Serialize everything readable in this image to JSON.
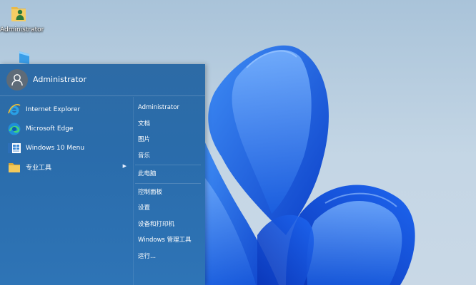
{
  "desktop": {
    "icons": [
      {
        "label": "Administrator",
        "icon": "user-folder-icon"
      },
      {
        "label": "",
        "icon": "this-pc-icon"
      }
    ]
  },
  "start_menu": {
    "user": {
      "name": "Administrator",
      "icon": "user-avatar-icon"
    },
    "programs": [
      {
        "label": "Internet Explorer",
        "icon": "internet-explorer-icon"
      },
      {
        "label": "Microsoft Edge",
        "icon": "microsoft-edge-icon"
      },
      {
        "label": "Windows 10 Menu",
        "icon": "windows-10-menu-icon"
      },
      {
        "label": "专业工具",
        "icon": "folder-icon",
        "has_submenu": true
      }
    ],
    "places": {
      "group1": [
        "Administrator",
        "文档",
        "图片",
        "音乐"
      ],
      "group2": [
        "此电脑"
      ],
      "group3": [
        "控制面板",
        "设置",
        "设备和打印机",
        "Windows 管理工具",
        "运行..."
      ]
    }
  },
  "colors": {
    "menu_bg": "#2a6cab",
    "wallpaper_blue": "#1a5fe0"
  }
}
